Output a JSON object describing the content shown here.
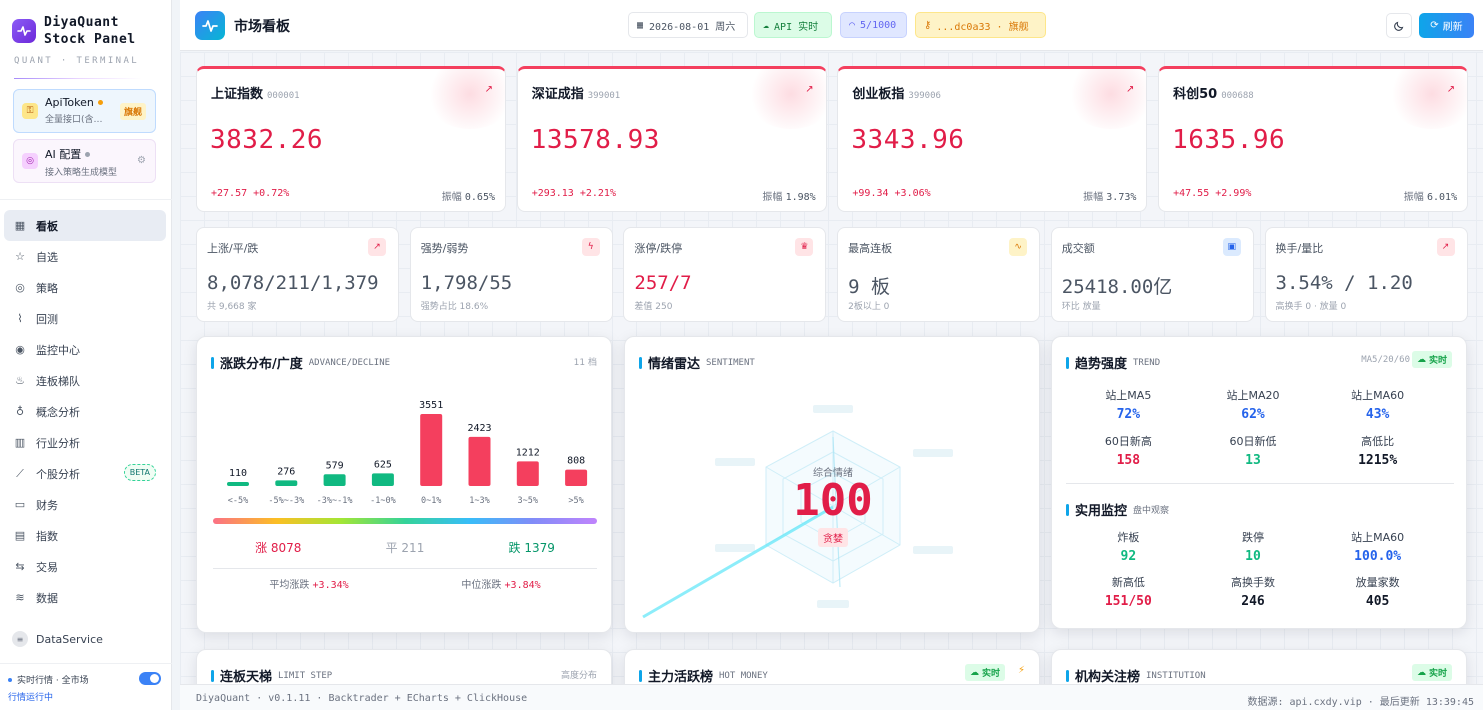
{
  "brand": {
    "line1": "DiyaQuant",
    "line2": "Stock Panel",
    "sub": "QUANT · TERMINAL"
  },
  "config": [
    {
      "title": "ApiToken",
      "desc": "全量接口(含…",
      "badge": "旗舰",
      "dot_color": "#f59e0b"
    },
    {
      "title": "AI 配置",
      "desc": "接入策略生成模型",
      "dot_color": "#9ca3af"
    }
  ],
  "nav": [
    {
      "label": "看板",
      "icon": "dashboard-icon",
      "active": true
    },
    {
      "label": "自选",
      "icon": "star-icon"
    },
    {
      "label": "策略",
      "icon": "strategy-icon"
    },
    {
      "label": "回测",
      "icon": "backtest-icon"
    },
    {
      "label": "监控中心",
      "icon": "monitor-icon"
    },
    {
      "label": "连板梯队",
      "icon": "fire-icon"
    },
    {
      "label": "概念分析",
      "icon": "bulb-icon"
    },
    {
      "label": "行业分析",
      "icon": "bar-chart-icon"
    },
    {
      "label": "个股分析",
      "icon": "line-chart-icon",
      "badge": "BETA"
    },
    {
      "label": "财务",
      "icon": "wallet-icon"
    },
    {
      "label": "指数",
      "icon": "index-icon"
    },
    {
      "label": "交易",
      "icon": "exchange-icon"
    },
    {
      "label": "数据",
      "icon": "database-icon"
    }
  ],
  "data_service": "DataService",
  "realtime": {
    "label": "实时行情 · 全市场",
    "status": "行情运行中",
    "enabled": true
  },
  "topbar": {
    "title": "市场看板",
    "date": "2026-08-01 周六",
    "api": "API 实时",
    "quota": "5/1000",
    "key": "...dc0a33 · 旗舰",
    "refresh": "刷新"
  },
  "indices": [
    {
      "name": "上证指数",
      "code": "000001",
      "value": "3832.26",
      "change": "+27.57 +0.72%",
      "amp_label": "振幅",
      "amp": "0.65%"
    },
    {
      "name": "深证成指",
      "code": "399001",
      "value": "13578.93",
      "change": "+293.13 +2.21%",
      "amp_label": "振幅",
      "amp": "1.98%"
    },
    {
      "name": "创业板指",
      "code": "399006",
      "value": "3343.96",
      "change": "+99.34 +3.06%",
      "amp_label": "振幅",
      "amp": "3.73%"
    },
    {
      "name": "科创50",
      "code": "000688",
      "value": "1635.96",
      "change": "+47.55 +2.99%",
      "amp_label": "振幅",
      "amp": "6.01%"
    }
  ],
  "stats": [
    {
      "label": "上涨/平/跌",
      "value": "8,078/211/1,379",
      "sub": "共 9,668 家",
      "icon": "trend-up-icon",
      "icon_bg": "#ffe4e6",
      "icon_color": "#e11d48"
    },
    {
      "label": "强势/弱势",
      "value": "1,798/55",
      "sub": "强势占比 18.6%",
      "icon": "bolt-icon",
      "icon_bg": "#ffe4e6",
      "icon_color": "#e11d48"
    },
    {
      "label": "涨停/跌停",
      "value": "257/7",
      "sub": "差值 250",
      "icon": "crown-icon",
      "icon_bg": "#ffe4e6",
      "icon_color": "#e11d48",
      "value_color": "#e11d48"
    },
    {
      "label": "最高连板",
      "value": "9 板",
      "sub": "2板以上 0",
      "icon": "pulse-icon",
      "icon_bg": "#fef3c7",
      "icon_color": "#d97706"
    },
    {
      "label": "成交额",
      "value": "25418.00亿",
      "sub": "环比 放量",
      "icon": "database-icon",
      "icon_bg": "#dbeafe",
      "icon_color": "#2563eb"
    },
    {
      "label": "换手/量比",
      "value": "3.54% / 1.20",
      "sub": "高换手 0 · 放量 0",
      "icon": "trend-up-icon",
      "icon_bg": "#ffe4e6",
      "icon_color": "#e11d48"
    }
  ],
  "advance": {
    "title": "涨跌分布/广度",
    "en": "ADVANCE/DECLINE",
    "right": "11 档",
    "up": "涨 8078",
    "flat": "平 211",
    "down": "跌 1379",
    "avg_label": "平均涨跌",
    "avg": "+3.34%",
    "median_label": "中位涨跌",
    "median": "+3.84%"
  },
  "chart_data": {
    "type": "bar",
    "categories": [
      "<-5%",
      "-5%~-3%",
      "-3%~-1%",
      "-1~0%",
      "0~1%",
      "1~3%",
      "3~5%",
      ">5%"
    ],
    "values": [
      110,
      276,
      579,
      625,
      3551,
      2423,
      1212,
      808
    ],
    "colors": [
      "#10b981",
      "#10b981",
      "#10b981",
      "#10b981",
      "#f43f5e",
      "#f43f5e",
      "#f43f5e",
      "#f43f5e"
    ]
  },
  "sentiment": {
    "title": "情绪雷达",
    "en": "SENTIMENT",
    "label": "综合情绪",
    "value": "100",
    "tag": "贪婪"
  },
  "trend": {
    "title": "趋势强度",
    "en": "TREND",
    "right": "MA5/20/60",
    "live": "实时",
    "items": [
      {
        "label": "站上MA5",
        "value": "72%",
        "color": "#2563eb"
      },
      {
        "label": "站上MA20",
        "value": "62%",
        "color": "#2563eb"
      },
      {
        "label": "站上MA60",
        "value": "43%",
        "color": "#2563eb"
      },
      {
        "label": "60日新高",
        "value": "158",
        "color": "#e11d48"
      },
      {
        "label": "60日新低",
        "value": "13",
        "color": "#10b981"
      },
      {
        "label": "高低比",
        "value": "1215%",
        "color": "#111827"
      }
    ]
  },
  "practical": {
    "title": "实用监控",
    "sub": "盘中观察",
    "items": [
      {
        "label": "炸板",
        "value": "92",
        "color": "#10b981"
      },
      {
        "label": "跌停",
        "value": "10",
        "color": "#10b981"
      },
      {
        "label": "站上MA60",
        "value": "100.0%",
        "color": "#2563eb"
      },
      {
        "label": "新高低",
        "value": "151/50",
        "color": "#e11d48"
      },
      {
        "label": "高换手数",
        "value": "246",
        "color": "#111827"
      },
      {
        "label": "放量家数",
        "value": "405",
        "color": "#111827"
      }
    ]
  },
  "bottom_panels": [
    {
      "title": "连板天梯",
      "en": "LIMIT STEP",
      "right": "高度分布"
    },
    {
      "title": "主力活跃榜",
      "en": "HOT MONEY",
      "live": "实时"
    },
    {
      "title": "机构关注榜",
      "en": "INSTITUTION",
      "live": "实时"
    }
  ],
  "footer": {
    "left": "DiyaQuant · v0.1.11 · Backtrader + ECharts + ClickHouse",
    "right": "数据源: api.cxdy.vip · 最后更新 13:39:45"
  },
  "colors": {
    "up": "#e11d48",
    "down": "#10b981",
    "accent": "#0ea5e9"
  }
}
